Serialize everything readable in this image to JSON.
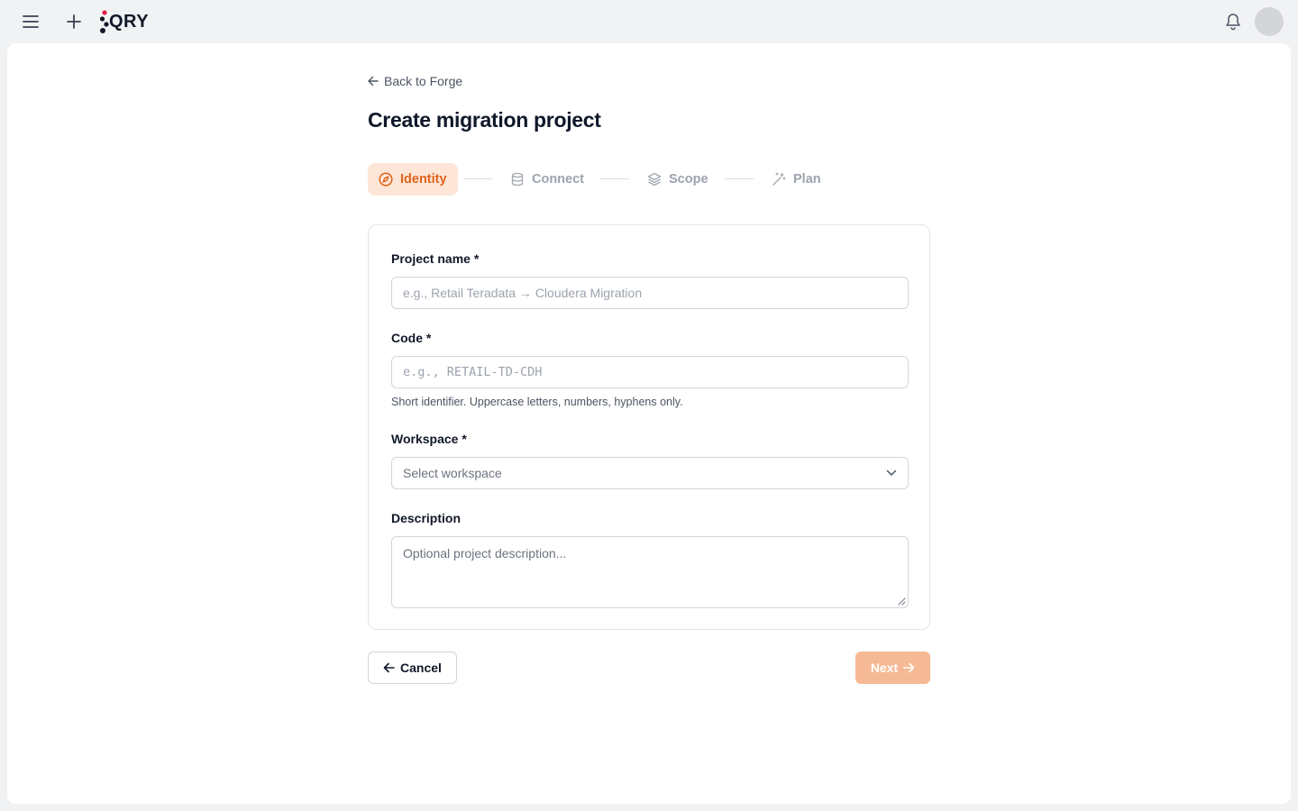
{
  "app": {
    "logo_text": "QRY",
    "icons": {
      "menu": "menu-icon",
      "add": "plus-icon",
      "notifications": "bell-icon"
    }
  },
  "page": {
    "back_link": "Back to Forge",
    "title": "Create migration project"
  },
  "stepper": {
    "steps": [
      {
        "label": "Identity",
        "icon": "compass-icon",
        "active": true
      },
      {
        "label": "Connect",
        "icon": "database-icon",
        "active": false
      },
      {
        "label": "Scope",
        "icon": "layers-icon",
        "active": false
      },
      {
        "label": "Plan",
        "icon": "magic-wand-icon",
        "active": false
      }
    ]
  },
  "form": {
    "project_name": {
      "label": "Project name *",
      "placeholder": "e.g., Retail Teradata → Cloudera Migration",
      "value": ""
    },
    "code": {
      "label": "Code *",
      "placeholder": "e.g., RETAIL-TD-CDH",
      "value": "",
      "hint": "Short identifier. Uppercase letters, numbers, hyphens only."
    },
    "workspace": {
      "label": "Workspace *",
      "placeholder": "Select workspace"
    },
    "description": {
      "label": "Description",
      "placeholder": "Optional project description..."
    }
  },
  "actions": {
    "cancel_label": "Cancel",
    "next_label": "Next"
  },
  "colors": {
    "accent": "#e2621b",
    "accent_bg": "#fde6d8",
    "next_disabled": "#f6b995"
  }
}
